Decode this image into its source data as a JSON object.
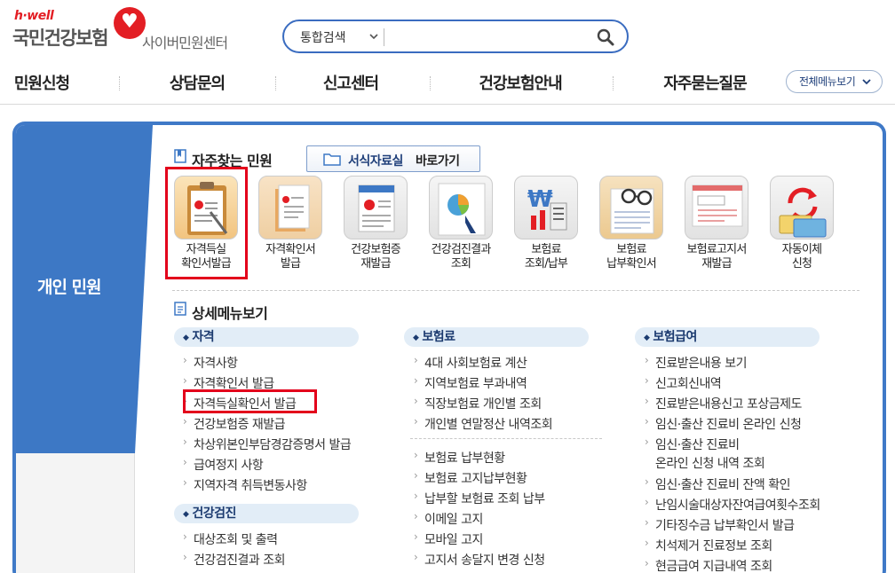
{
  "header": {
    "logo_hwell": "h·well",
    "logo_main": "국민건강보험",
    "logo_sub": "사이버민원센터",
    "search": {
      "scope": "통합검색",
      "placeholder": "",
      "value": ""
    }
  },
  "gnb": {
    "items": [
      "민원신청",
      "상담문의",
      "신고센터",
      "건강보험안내",
      "자주묻는질문"
    ],
    "all_menu": "전체메뉴보기"
  },
  "side": {
    "label": "개인 민원"
  },
  "quick": {
    "title": "자주찾는 민원",
    "forms_btn_1": "서식자료실",
    "forms_btn_2": "바로가기",
    "items": [
      {
        "line1": "자격득실",
        "line2": "확인서발급"
      },
      {
        "line1": "자격확인서",
        "line2": "발급"
      },
      {
        "line1": "건강보험증",
        "line2": "재발급"
      },
      {
        "line1": "건강검진결과",
        "line2": "조회"
      },
      {
        "line1": "보험료",
        "line2": "조회/납부"
      },
      {
        "line1": "보험료",
        "line2": "납부확인서"
      },
      {
        "line1": "보험료고지서",
        "line2": "재발급"
      },
      {
        "line1": "자동이체",
        "line2": "신청"
      }
    ]
  },
  "detail": {
    "title": "상세메뉴보기",
    "col1": {
      "cat1": "자격",
      "links1": [
        "자격사항",
        "자격확인서 발급",
        "자격득실확인서 발급",
        "건강보험증 재발급",
        "차상위본인부담경감증명서 발급",
        "급여정지 사항",
        "지역자격 취득변동사항"
      ],
      "cat2": "건강검진",
      "links2": [
        "대상조회 및 출력",
        "건강검진결과 조회"
      ]
    },
    "col2": {
      "cat1": "보험료",
      "links1": [
        "4대 사회보험료 계산",
        "지역보험료 부과내역",
        "직장보험료 개인별 조회",
        "개인별 연말정산 내역조회"
      ],
      "links2": [
        "보험료 납부현황",
        "보험료 고지납부현황",
        "납부할 보험료 조회 납부",
        "이메일 고지",
        "모바일 고지",
        "고지서 송달지 변경 신청"
      ]
    },
    "col3": {
      "cat1": "보험급여",
      "links1": [
        "진료받은내용 보기",
        "신고회신내역",
        "진료받은내용신고 포상금제도",
        "임신·출산 진료비 온라인 신청"
      ],
      "multi1": "임신·출산 진료비",
      "multi2": "온라인 신청 내역 조회",
      "links2": [
        "임신·출산 진료비 잔액 확인",
        "난임시술대상자잔여급여횟수조회",
        "기타징수금 납부확인서 발급",
        "치석제거 진료정보 조회",
        "현금급여 지급내역 조회"
      ]
    }
  },
  "colors": {
    "accent": "#3d78c5",
    "highlight": "#e3001b",
    "brand": "#e31e24"
  }
}
